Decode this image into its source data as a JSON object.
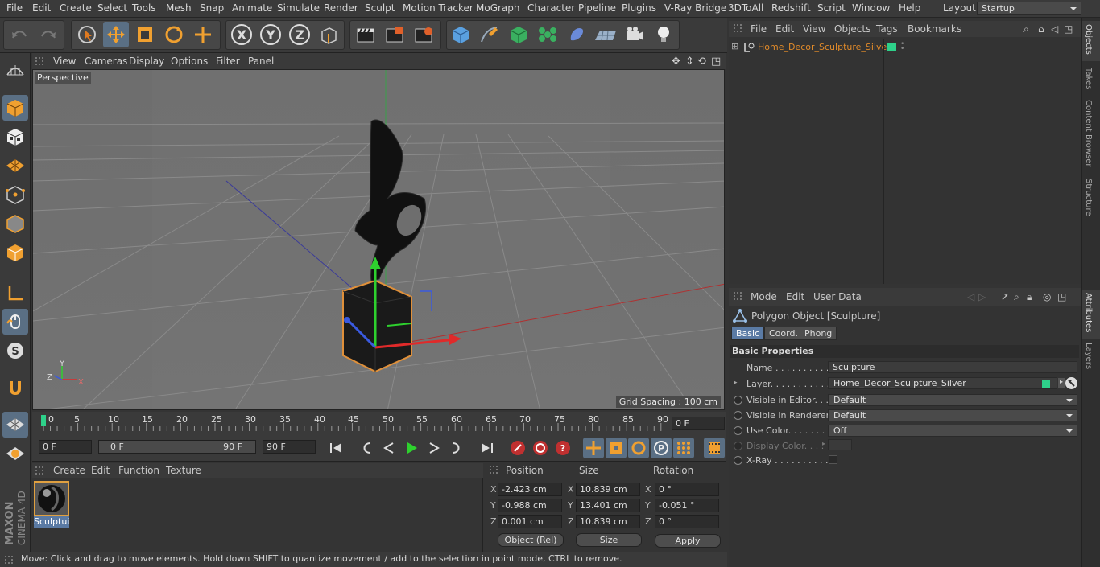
{
  "menu": {
    "items": [
      "File",
      "Edit",
      "Create",
      "Select",
      "Tools",
      "Mesh",
      "Snap",
      "Animate",
      "Simulate",
      "Render",
      "Sculpt",
      "Motion Tracker",
      "MoGraph",
      "Character",
      "Pipeline",
      "Plugins",
      "V-Ray Bridge",
      "3DToAll",
      "Redshift",
      "Script",
      "Window",
      "Help"
    ],
    "layout_label": "Layout:",
    "layout_value": "Startup"
  },
  "toolbar": {
    "icons": [
      "undo-icon",
      "redo-icon",
      "live-selection-icon",
      "move-icon",
      "scale-icon",
      "rotate-icon",
      "last-tool-icon",
      "x-axis-icon",
      "y-axis-icon",
      "z-axis-icon",
      "coordinate-system-icon",
      "render-view-icon",
      "render-picture-viewer-icon",
      "render-settings-icon",
      "cube-primitive-icon",
      "pen-spline-icon",
      "subdivision-surface-icon",
      "cloner-icon",
      "deformer-icon",
      "floor-icon",
      "camera-icon",
      "light-icon"
    ],
    "axis_x": "X",
    "axis_y": "Y",
    "axis_z": "Z"
  },
  "viewport": {
    "menu": [
      "View",
      "Cameras",
      "Display",
      "Options",
      "Filter",
      "Panel"
    ],
    "label": "Perspective",
    "grid_spacing": "Grid Spacing : 100 cm",
    "axis_x": "X",
    "axis_y": "Y",
    "axis_z": "Z"
  },
  "timeline": {
    "ticks": [
      "0",
      "5",
      "10",
      "15",
      "20",
      "25",
      "30",
      "35",
      "40",
      "45",
      "50",
      "55",
      "60",
      "65",
      "70",
      "75",
      "80",
      "85",
      "90"
    ],
    "current_frame": "0 F"
  },
  "playbar": {
    "start_frame": "0 F",
    "range_start": "0 F",
    "range_end": "90 F",
    "end_frame": "90 F"
  },
  "materials": {
    "menu": [
      "Create",
      "Edit",
      "Function",
      "Texture"
    ],
    "items": [
      {
        "name": "Sculptui"
      }
    ]
  },
  "coordinates": {
    "headers": {
      "position": "Position",
      "size": "Size",
      "rotation": "Rotation"
    },
    "rows": [
      {
        "axis": "X",
        "pos": "-2.423 cm",
        "size_axis": "X",
        "size": "10.839 cm",
        "rot_axis": "X",
        "rot": "0 °"
      },
      {
        "axis": "Y",
        "pos": "-0.988 cm",
        "size_axis": "Y",
        "size": "13.401 cm",
        "rot_axis": "Y",
        "rot": "-0.051 °"
      },
      {
        "axis": "Z",
        "pos": "0.001 cm",
        "size_axis": "Z",
        "size": "10.839 cm",
        "rot_axis": "Z",
        "rot": "0 °"
      }
    ],
    "mode": "Object (Rel)",
    "size_mode": "Size",
    "apply": "Apply"
  },
  "status": "Move: Click and drag to move elements. Hold down SHIFT to quantize movement / add to the selection in point mode, CTRL to remove.",
  "brand": {
    "maxon": "MAXON",
    "product": "CINEMA 4D"
  },
  "objects": {
    "menu": [
      "File",
      "Edit",
      "View",
      "Objects",
      "Tags",
      "Bookmarks"
    ],
    "items": [
      {
        "name": "Home_Decor_Sculpture_Silver",
        "color": "#e08a2a",
        "layer_color": "#2ed18a"
      }
    ]
  },
  "attributes": {
    "menu": [
      "Mode",
      "Edit",
      "User Data"
    ],
    "title": "Polygon Object [Sculpture]",
    "tabs": [
      "Basic",
      "Coord.",
      "Phong"
    ],
    "section": "Basic Properties",
    "props": {
      "name_label": "Name . . . . . . . . . . . .",
      "name_value": "Sculpture",
      "layer_label": "Layer. . . . . . . . . . . .",
      "layer_value": "Home_Decor_Sculpture_Silver",
      "vis_editor_label": "Visible in Editor. . .",
      "vis_editor_value": "Default",
      "vis_render_label": "Visible in Renderer",
      "vis_render_value": "Default",
      "use_color_label": "Use Color. . . . . . . .",
      "use_color_value": "Off",
      "display_color_label": "Display Color. . . .",
      "xray_label": "X-Ray . . . . . . . . . . ."
    }
  },
  "side_tabs": [
    "Objects",
    "Takes",
    "Content Browser",
    "Structure",
    "Attributes",
    "Layers"
  ],
  "colors": {
    "accent_blue": "#5a7aa4",
    "object_orange": "#e08a2a",
    "layer_green": "#2ed18a"
  }
}
